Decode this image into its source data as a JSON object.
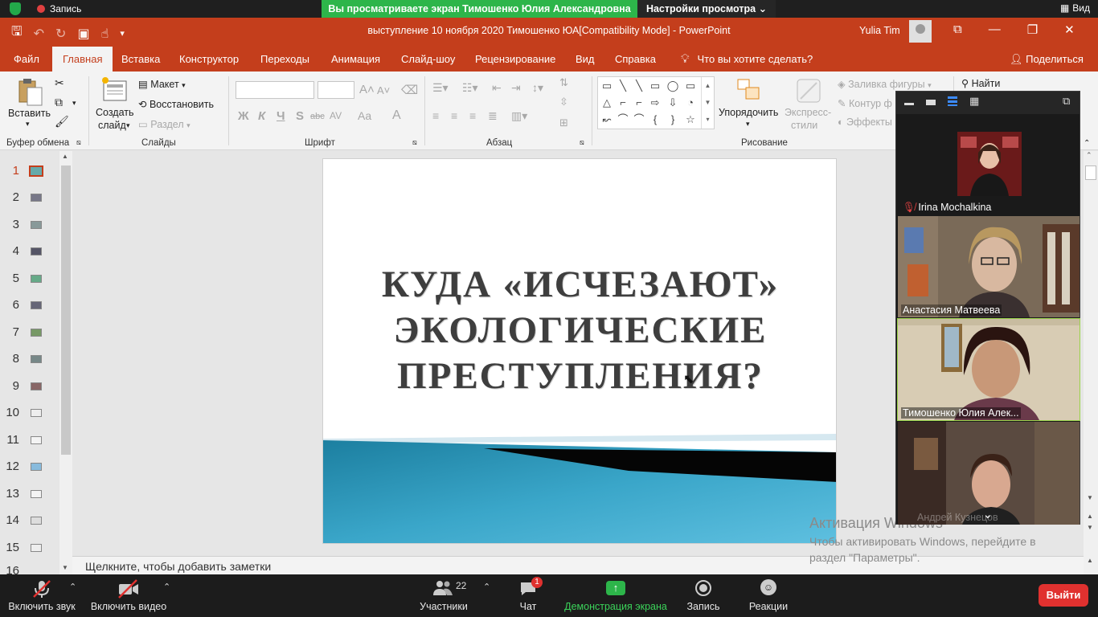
{
  "zoom_top": {
    "recording_label": "Запись",
    "viewing_banner": "Вы просматриваете экран Тимошенко Юлия Александровна",
    "view_settings": "Настройки просмотра",
    "view_label": "Вид"
  },
  "titlebar": {
    "doc_title": "выступление 10 ноября 2020  Тимошенко ЮА[Compatibility Mode]  -  PowerPoint",
    "user_name": "Yulia Tim"
  },
  "tabs": [
    {
      "label": "Файл"
    },
    {
      "label": "Главная"
    },
    {
      "label": "Вставка"
    },
    {
      "label": "Конструктор"
    },
    {
      "label": "Переходы"
    },
    {
      "label": "Анимация"
    },
    {
      "label": "Слайд-шоу"
    },
    {
      "label": "Рецензирование"
    },
    {
      "label": "Вид"
    },
    {
      "label": "Справка"
    }
  ],
  "tell_me": "Что вы хотите сделать?",
  "share": "Поделиться",
  "ribbon": {
    "paste": "Вставить",
    "create_slide_1": "Создать",
    "create_slide_2": "слайд",
    "layout": "Макет",
    "reset": "Восстановить",
    "section": "Раздел",
    "arrange": "Упорядочить",
    "quick_styles_1": "Экспресс-",
    "quick_styles_2": "стили",
    "shape_fill": "Заливка фигуры",
    "shape_outline": "Контур ф",
    "shape_effects": "Эффекты",
    "find": "Найти",
    "font_bold": "Ж",
    "font_italic": "К",
    "font_underline": "Ч",
    "font_shadow": "S",
    "font_strike": "abc",
    "font_spacing": "AV",
    "font_case": "Aa",
    "font_color": "A"
  },
  "group_labels": {
    "clipboard": "Буфер обмена",
    "slides": "Слайды",
    "font": "Шрифт",
    "paragraph": "Абзац",
    "drawing": "Рисование"
  },
  "thumbnails": [
    "1",
    "2",
    "3",
    "4",
    "5",
    "6",
    "7",
    "8",
    "9",
    "10",
    "11",
    "12",
    "13",
    "14",
    "15",
    "16"
  ],
  "slide": {
    "title_line1": "КУДА «ИСЧЕЗАЮТ»",
    "title_line2": "ЭКОЛОГИЧЕСКИЕ",
    "title_line3": "ПРЕСТУПЛЕНИЯ?"
  },
  "notes_placeholder": "Щелкните, чтобы добавить заметки",
  "activation": {
    "title": "Активация Windows",
    "line1": "Чтобы активировать Windows, перейдите в",
    "line2": "раздел \"Параметры\"."
  },
  "participants_video": [
    {
      "name": "Irina Mochalkina"
    },
    {
      "name": "Анастасия Матвеева"
    },
    {
      "name": "Тимошенко Юлия Алек..."
    },
    {
      "name": "Андрей Кузнецов"
    }
  ],
  "zoom_toolbar": {
    "unmute": "Включить звук",
    "start_video": "Включить видео",
    "participants": "Участники",
    "participants_count": "22",
    "chat": "Чат",
    "chat_badge": "1",
    "share_screen": "Демонстрация экрана",
    "record": "Запись",
    "reactions": "Реакции",
    "leave": "Выйти"
  },
  "colors": {
    "ppt_accent": "#c43e1c",
    "zoom_green": "#2db54a",
    "leave_red": "#e0312f"
  }
}
